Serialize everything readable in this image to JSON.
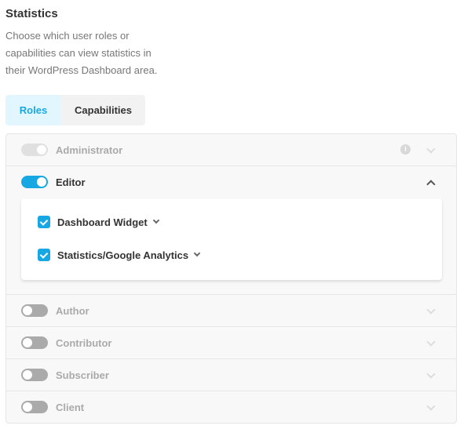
{
  "section": {
    "title": "Statistics",
    "description": "Choose which user roles or capabilities can view statistics in their WordPress Dashboard area."
  },
  "tabs": [
    {
      "label": "Roles",
      "active": true
    },
    {
      "label": "Capabilities",
      "active": false
    }
  ],
  "roles": [
    {
      "label": "Administrator",
      "enabled": true,
      "disabled": true,
      "expanded": false
    },
    {
      "label": "Editor",
      "enabled": true,
      "disabled": false,
      "expanded": true,
      "capabilities": [
        {
          "label": "Dashboard Widget",
          "checked": true
        },
        {
          "label": "Statistics/Google Analytics",
          "checked": true
        }
      ]
    },
    {
      "label": "Author",
      "enabled": false,
      "expanded": false
    },
    {
      "label": "Contributor",
      "enabled": false,
      "expanded": false
    },
    {
      "label": "Subscriber",
      "enabled": false,
      "expanded": false
    },
    {
      "label": "Client",
      "enabled": false,
      "expanded": false
    }
  ],
  "colors": {
    "accent": "#17a8e3",
    "tab_active_bg": "#e1f6ff",
    "toggle_off": "#aaaaaa"
  }
}
